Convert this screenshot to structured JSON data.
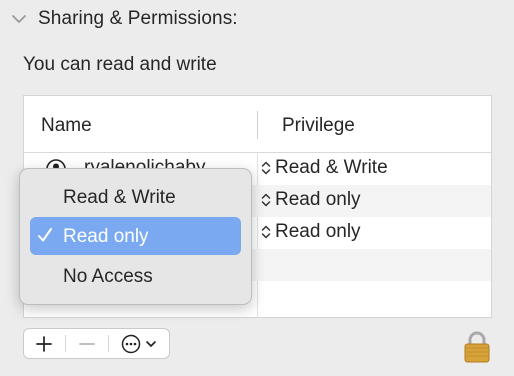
{
  "section": {
    "title": "Sharing & Permissions:"
  },
  "access_text": "You can read and write",
  "table": {
    "columns": [
      "Name",
      "Privilege"
    ],
    "rows": [
      {
        "name": "ryalenolichaby",
        "privilege": "Read & Write"
      },
      {
        "name": "",
        "privilege": "Read only"
      },
      {
        "name": "",
        "privilege": "Read only"
      }
    ]
  },
  "menu": {
    "items": [
      "Read & Write",
      "Read only",
      "No Access"
    ],
    "selected": "Read only",
    "selected_color": "#7aa9f1"
  },
  "toolbar": {
    "add_icon": "plus-icon",
    "remove_icon": "minus-icon",
    "action_icon": "ellipsis-circle-icon"
  },
  "lock_icon": "lock-icon"
}
